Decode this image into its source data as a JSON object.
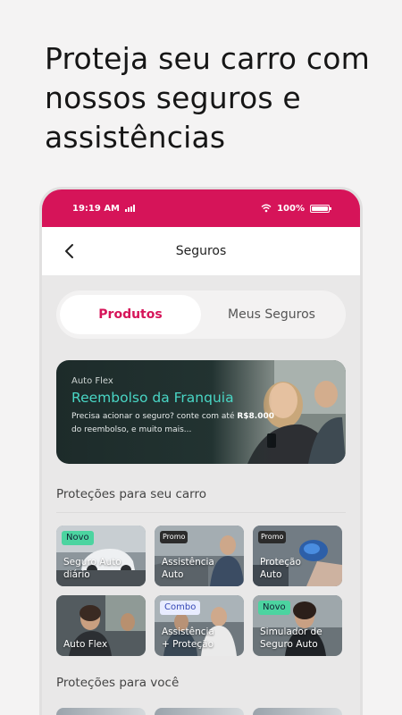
{
  "headline": "Proteja seu carro com nossos seguros e assistências",
  "status": {
    "time": "19:19 AM",
    "battery": "100%"
  },
  "appbar": {
    "title": "Seguros"
  },
  "tabs": [
    {
      "label": "Produtos",
      "active": true
    },
    {
      "label": "Meus Seguros",
      "active": false
    }
  ],
  "banner": {
    "kicker": "Auto Flex",
    "title": "Reembolso da Franquia",
    "desc_start": "Precisa acionar o seguro? conte com até ",
    "desc_bold": "R$8.000",
    "desc_end": " do reembolso, e muito mais..."
  },
  "sections": {
    "car_title": "Proteções para seu carro",
    "you_title": "Proteções para você"
  },
  "cards": [
    {
      "label_1": "Seguro Auto",
      "label_2": "diário",
      "badge": "Novo"
    },
    {
      "label_1": "Assistência",
      "label_2": "Auto",
      "badge": "Promo"
    },
    {
      "label_1": "Proteção",
      "label_2": "Auto",
      "badge": "Promo"
    },
    {
      "label_1": "Auto Flex",
      "label_2": "",
      "badge": ""
    },
    {
      "label_1": "Assistência",
      "label_2": "+ Proteção",
      "badge": "Combo"
    },
    {
      "label_1": "Simulador de",
      "label_2": "Seguro Auto",
      "badge": "Novo"
    }
  ],
  "colors": {
    "brand": "#d61459",
    "accent_teal": "#49d6c5",
    "badge_new": "#4cd4a0"
  }
}
